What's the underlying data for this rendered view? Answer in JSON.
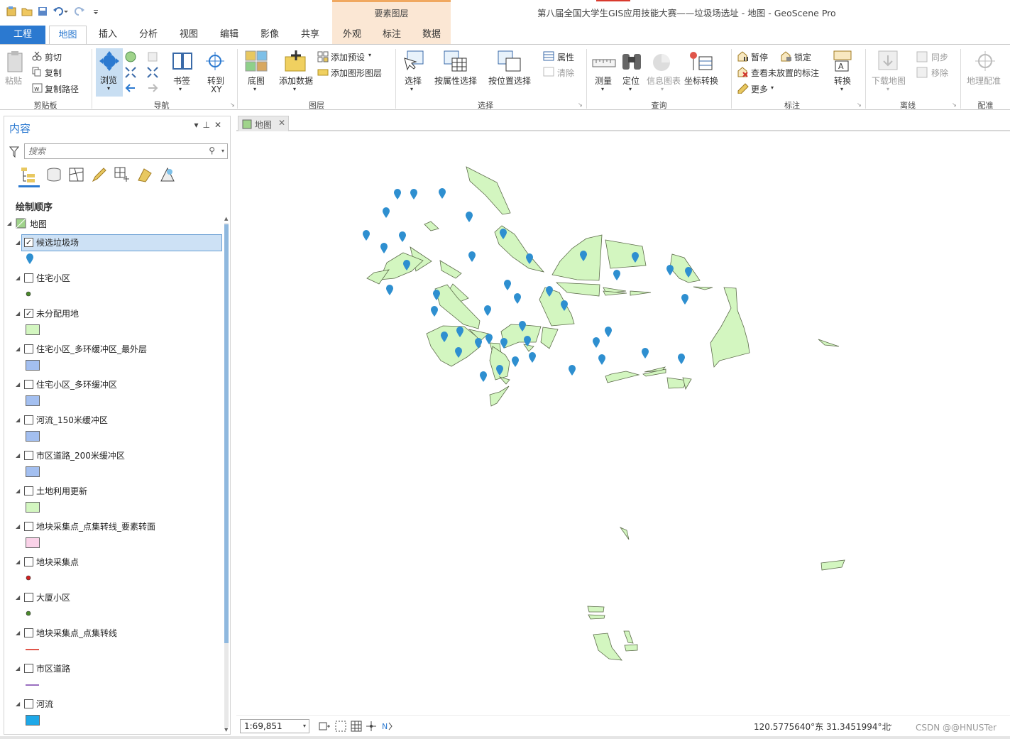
{
  "window": {
    "title": "第八届全国大学生GIS应用技能大赛——垃圾场选址 - 地图 - GeoScene Pro"
  },
  "context_tab_header": "要素图层",
  "tabs": [
    "工程",
    "地图",
    "插入",
    "分析",
    "视图",
    "编辑",
    "影像",
    "共享",
    "外观",
    "标注",
    "数据"
  ],
  "ribbon": {
    "clipboard": {
      "paste": "粘贴",
      "cut": "剪切",
      "copy": "复制",
      "copy_path": "复制路径",
      "label": "剪贴板"
    },
    "navigate": {
      "explore": "浏览",
      "bookmarks": "书签",
      "goto_xy_1": "转到",
      "goto_xy_2": "XY",
      "label": "导航"
    },
    "layer": {
      "basemap": "底图",
      "add_data": "添加数据",
      "add_preset": "添加预设",
      "add_graphics": "添加图形图层",
      "label": "图层"
    },
    "selection": {
      "select": "选择",
      "select_by_attr": "按属性选择",
      "select_by_loc": "按位置选择",
      "attributes": "属性",
      "clear": "清除",
      "label": "选择"
    },
    "inquiry": {
      "measure": "测量",
      "locate": "定位",
      "infographics": "信息图表",
      "convert_coords": "坐标转换",
      "label": "查询"
    },
    "labeling": {
      "pause": "暂停",
      "lock": "锁定",
      "view_unplaced": "查看未放置的标注",
      "more": "更多",
      "convert": "转换",
      "label": "标注"
    },
    "offline": {
      "download_map": "下载地图",
      "sync": "同步",
      "remove": "移除",
      "label": "离线"
    },
    "georef": {
      "georeference": "地理配准",
      "label": "配准"
    }
  },
  "contents": {
    "title": "内容",
    "search_placeholder": "搜索",
    "drawing_order": "绘制顺序",
    "map_name": "地图",
    "layers": [
      {
        "name": "候选垃圾场",
        "checked": true,
        "symbol": "marker",
        "color": "#2e8fd0",
        "selected": true
      },
      {
        "name": "住宅小区",
        "checked": false,
        "symbol": "dot",
        "color": "#4a8a2a"
      },
      {
        "name": "未分配用地",
        "checked": true,
        "symbol": "fill",
        "color": "#d3f6c0"
      },
      {
        "name": "住宅小区_多环缓冲区_最外层",
        "checked": false,
        "symbol": "fill",
        "color": "#a3bff0"
      },
      {
        "name": "住宅小区_多环缓冲区",
        "checked": false,
        "symbol": "fill",
        "color": "#a3bff0"
      },
      {
        "name": "河流_150米缓冲区",
        "checked": false,
        "symbol": "fill",
        "color": "#a3bff0"
      },
      {
        "name": "市区道路_200米缓冲区",
        "checked": false,
        "symbol": "fill",
        "color": "#a3bff0"
      },
      {
        "name": "土地利用更新",
        "checked": false,
        "symbol": "fill",
        "color": "#d3f6c0"
      },
      {
        "name": "地块采集点_点集转线_要素转面",
        "checked": false,
        "symbol": "fill",
        "color": "#fad2e8"
      },
      {
        "name": "地块采集点",
        "checked": false,
        "symbol": "dot",
        "color": "#d42020"
      },
      {
        "name": "大厦小区",
        "checked": false,
        "symbol": "dot",
        "color": "#4a8a2a"
      },
      {
        "name": "地块采集点_点集转线",
        "checked": false,
        "symbol": "line",
        "color": "#e0554a"
      },
      {
        "name": "市区道路",
        "checked": false,
        "symbol": "line",
        "color": "#9a6fc0"
      },
      {
        "name": "河流",
        "checked": true,
        "symbol": "fill",
        "color": "#1ea8e8",
        "checked_display": false
      }
    ]
  },
  "map_view": {
    "tab_label": "地图",
    "scale": "1:69,851",
    "coordinates": "120.5775640°东 31.3451994°北"
  },
  "watermark": "CSDN @@HNUSTer",
  "colors": {
    "accent": "#2b79d0",
    "parcel_fill": "#d3f6c0",
    "parcel_stroke": "#5c6b4a",
    "marker": "#2e8fd0"
  }
}
